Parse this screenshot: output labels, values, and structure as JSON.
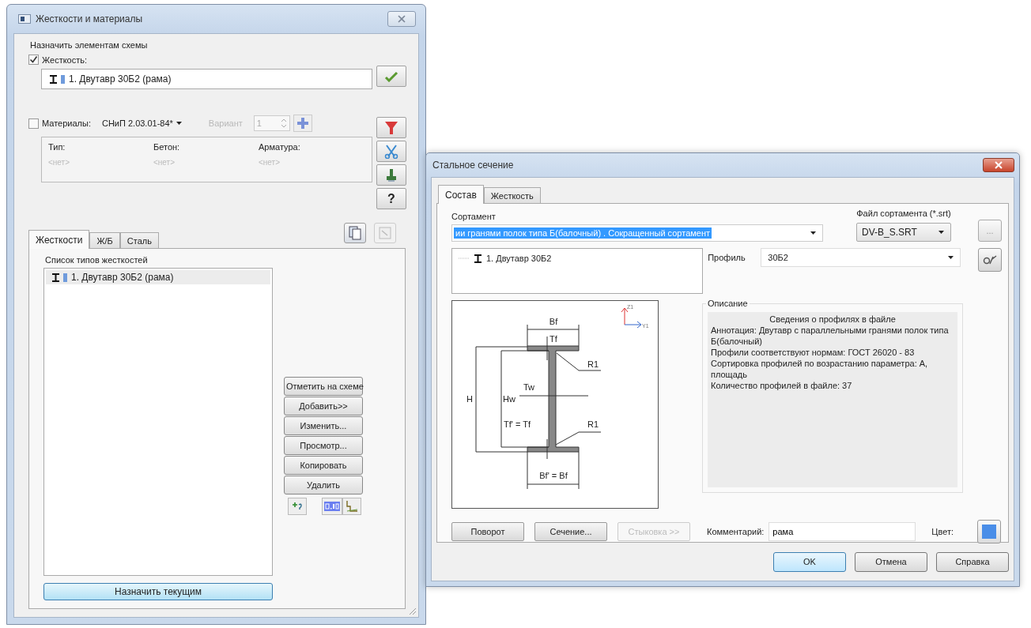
{
  "left_window": {
    "title": "Жесткости и материалы",
    "assign_group": {
      "label": "Назначить элементам схемы",
      "stiffness_checkbox": {
        "label": "Жесткость:",
        "checked": true
      },
      "stiffness_field": {
        "value": "1. Двутавр 30Б2 (рама)",
        "color": "#6f9bdc"
      },
      "materials_checkbox": {
        "label": "Материалы:",
        "checked": false
      },
      "norm_dropdown": {
        "value": "СНиП 2.03.01-84*"
      },
      "variant": {
        "label": "Вариант",
        "value": "1",
        "disabled": true
      },
      "materials_table": {
        "columns": [
          "Тип:",
          "Бетон:",
          "Арматура:"
        ],
        "rows": [
          [
            "<нет>",
            "<нет>",
            "<нет>"
          ]
        ]
      }
    },
    "side_buttons": [
      {
        "kind": "apply"
      },
      {
        "kind": "filter"
      },
      {
        "kind": "cut"
      },
      {
        "kind": "stamp"
      },
      {
        "kind": "help",
        "label": "?"
      }
    ],
    "toolbar_buttons": [
      {
        "kind": "copy",
        "disabled": false
      },
      {
        "kind": "paste",
        "disabled": true
      }
    ],
    "tabs": [
      {
        "label": "Жесткости",
        "selected": true
      },
      {
        "label": "Ж/Б",
        "selected": false
      },
      {
        "label": "Сталь",
        "selected": false
      }
    ],
    "list_label": "Список типов жесткостей",
    "stiffness_list": [
      {
        "label": "1. Двутавр 30Б2 (рама)",
        "color": "#6f9bdc",
        "selected": true
      }
    ],
    "actions": [
      "Отметить на схеме",
      "Добавить>>",
      "Изменить...",
      "Просмотр...",
      "Копировать",
      "Удалить"
    ],
    "assign_button": "Назначить текущим"
  },
  "right_window": {
    "title": "Стальное сечение",
    "tabs": [
      {
        "label": "Состав",
        "selected": true
      },
      {
        "label": "Жесткость",
        "selected": false
      }
    ],
    "assortment": {
      "label": "Сортамент",
      "value": "ии гранями полок типа Б(балочный) . Сокращенный сортамент"
    },
    "assortment_file": {
      "label": "Файл сортамента (*.srt)",
      "value": "DV-B_S.SRT"
    },
    "browse_button": "...",
    "profile_tree": [
      {
        "label": "1. Двутавр 30Б2"
      }
    ],
    "profile": {
      "label": "Профиль",
      "value": "30Б2"
    },
    "section_drawing": {
      "labels": [
        "Bf",
        "Tf",
        "R1",
        "H",
        "Hw",
        "Tw",
        "Tf' = Tf",
        "R1",
        "Bf' = Bf"
      ],
      "axes": [
        "Z1",
        "Y1"
      ]
    },
    "description": {
      "label": "Описание",
      "heading": "Сведения о профилях в файле",
      "lines": [
        "Аннотация: Двутавр с параллельными гранями полок типа Б(балочный)",
        "Профили соответствуют нормам: ГОСТ 26020 - 83",
        "Сортировка профилей по возрастанию параметра: А, площадь",
        "Количество профилей в файле: 37"
      ]
    },
    "buttons": [
      {
        "label": "Поворот",
        "disabled": false
      },
      {
        "label": "Сечение...",
        "disabled": false
      },
      {
        "label": "Стыковка >>",
        "disabled": true
      }
    ],
    "comment": {
      "label": "Комментарий:",
      "value": "рама"
    },
    "color": {
      "label": "Цвет:",
      "color": "#4a8ee8"
    },
    "dialog_buttons": [
      {
        "label": "OK",
        "default": true
      },
      {
        "label": "Отмена",
        "default": false
      },
      {
        "label": "Справка",
        "default": false
      }
    ]
  }
}
